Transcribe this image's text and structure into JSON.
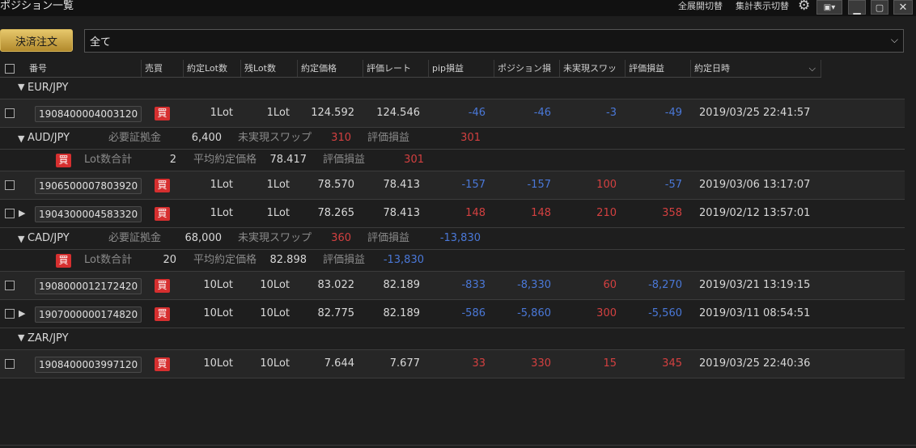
{
  "window": {
    "title": "ポジション一覧",
    "expand_toggle": "全展開切替",
    "summary_toggle": "集計表示切替"
  },
  "toolbar": {
    "settle_label": "決済注文",
    "filter_value": "全て"
  },
  "columns": [
    "番号",
    "売買",
    "約定Lot数",
    "残Lot数",
    "約定価格",
    "評価レート",
    "pip損益",
    "ポジション損益",
    "未実現スワップ",
    "評価損益",
    "約定日時"
  ],
  "labels": {
    "buy": "買",
    "required_margin": "必要証拠金",
    "unrealized_swap": "未実現スワップ",
    "valuation_pl": "評価損益",
    "lot_total": "Lot数合計",
    "avg_price": "平均約定価格"
  },
  "groups": {
    "eurjpy": {
      "pair": "EUR/JPY",
      "rows": [
        {
          "id": "1908400004003120",
          "lot": "1Lot",
          "remain": "1Lot",
          "price": "124.592",
          "rate": "124.546",
          "pip": "-46",
          "pos_pl": "-46",
          "swap": "-3",
          "eval_pl": "-49",
          "datetime": "2019/03/25 22:41:57"
        }
      ]
    },
    "audjpy": {
      "pair": "AUD/JPY",
      "margin": "6,400",
      "swap": "310",
      "eval_pl": "301",
      "summary": {
        "lots": "2",
        "avg": "78.417",
        "eval_pl": "301"
      },
      "rows": [
        {
          "id": "1906500007803920",
          "lot": "1Lot",
          "remain": "1Lot",
          "price": "78.570",
          "rate": "78.413",
          "pip": "-157",
          "pos_pl": "-157",
          "swap": "100",
          "eval_pl": "-57",
          "datetime": "2019/03/06 13:17:07"
        },
        {
          "id": "1904300004583320",
          "lot": "1Lot",
          "remain": "1Lot",
          "price": "78.265",
          "rate": "78.413",
          "pip": "148",
          "pos_pl": "148",
          "swap": "210",
          "eval_pl": "358",
          "datetime": "2019/02/12 13:57:01"
        }
      ]
    },
    "cadjpy": {
      "pair": "CAD/JPY",
      "margin": "68,000",
      "swap": "360",
      "eval_pl": "-13,830",
      "summary": {
        "lots": "20",
        "avg": "82.898",
        "eval_pl": "-13,830"
      },
      "rows": [
        {
          "id": "1908000012172420",
          "lot": "10Lot",
          "remain": "10Lot",
          "price": "83.022",
          "rate": "82.189",
          "pip": "-833",
          "pos_pl": "-8,330",
          "swap": "60",
          "eval_pl": "-8,270",
          "datetime": "2019/03/21 13:19:15"
        },
        {
          "id": "1907000000174820",
          "lot": "10Lot",
          "remain": "10Lot",
          "price": "82.775",
          "rate": "82.189",
          "pip": "-586",
          "pos_pl": "-5,860",
          "swap": "300",
          "eval_pl": "-5,560",
          "datetime": "2019/03/11 08:54:51"
        }
      ]
    },
    "zarjpy": {
      "pair": "ZAR/JPY",
      "rows": [
        {
          "id": "1908400003997120",
          "lot": "10Lot",
          "remain": "10Lot",
          "price": "7.644",
          "rate": "7.677",
          "pip": "33",
          "pos_pl": "330",
          "swap": "15",
          "eval_pl": "345",
          "datetime": "2019/03/25 22:40:36"
        }
      ]
    }
  },
  "colors": {
    "negative": "#4a78d8",
    "positive": "#d34040",
    "buy_badge": "#d62f2f",
    "accent": "#d9b85a"
  }
}
